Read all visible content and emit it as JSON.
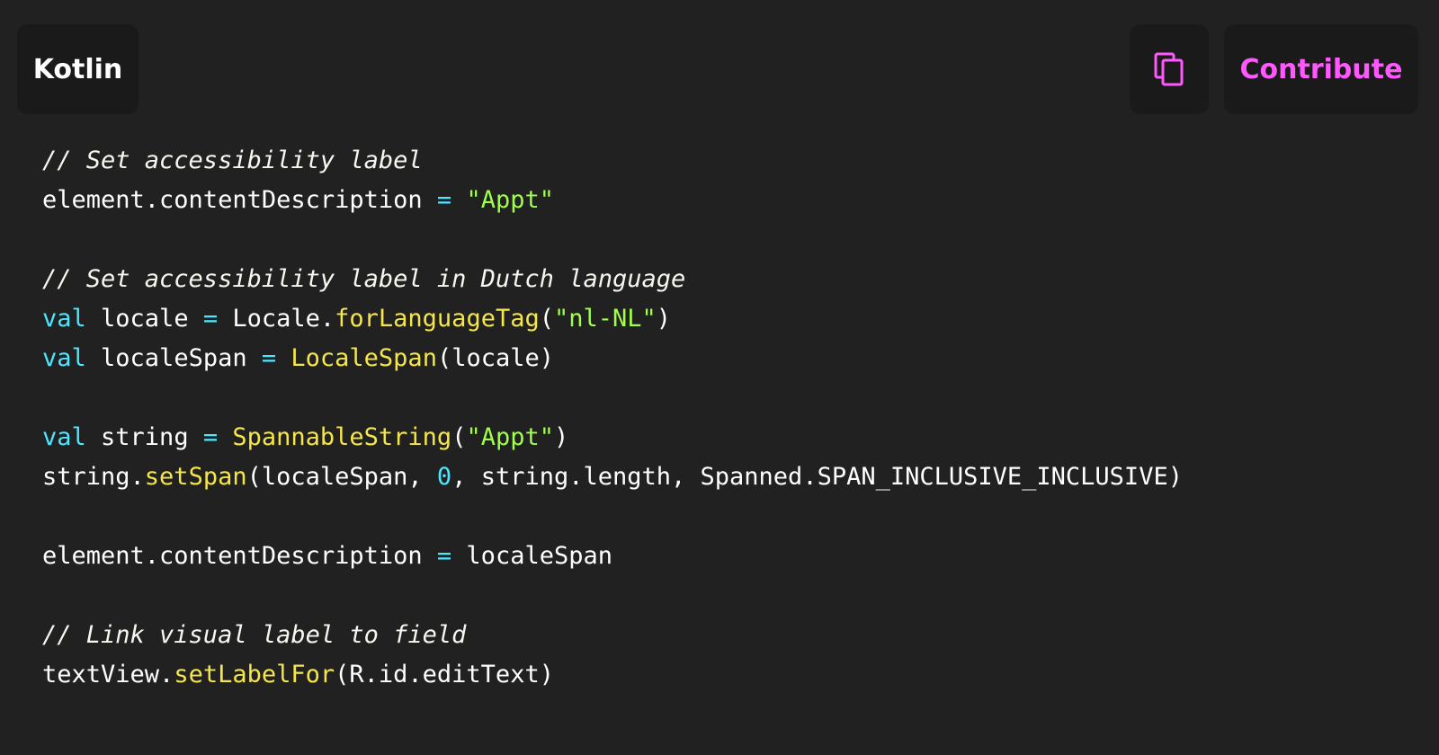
{
  "header": {
    "language_label": "Kotlin",
    "copy_icon": "copy-icon",
    "contribute_label": "Contribute"
  },
  "colors": {
    "background": "#212121",
    "button_background": "#1a1a1a",
    "accent": "#ff58ff",
    "keyword": "#4ee6ff",
    "function": "#f5e64a",
    "string": "#9fff4a"
  },
  "code": {
    "lines": [
      [
        {
          "text": "// Set accessibility label",
          "type": "cmt"
        }
      ],
      [
        {
          "text": "element.contentDescription ",
          "type": "plain"
        },
        {
          "text": "=",
          "type": "op"
        },
        {
          "text": " ",
          "type": "plain"
        },
        {
          "text": "\"Appt\"",
          "type": "str"
        }
      ],
      [],
      [
        {
          "text": "// Set accessibility label in Dutch language",
          "type": "cmt"
        }
      ],
      [
        {
          "text": "val",
          "type": "kw"
        },
        {
          "text": " locale ",
          "type": "plain"
        },
        {
          "text": "=",
          "type": "op"
        },
        {
          "text": " Locale.",
          "type": "plain"
        },
        {
          "text": "forLanguageTag",
          "type": "fn"
        },
        {
          "text": "(",
          "type": "plain"
        },
        {
          "text": "\"nl-NL\"",
          "type": "str"
        },
        {
          "text": ")",
          "type": "plain"
        }
      ],
      [
        {
          "text": "val",
          "type": "kw"
        },
        {
          "text": " localeSpan ",
          "type": "plain"
        },
        {
          "text": "=",
          "type": "op"
        },
        {
          "text": " ",
          "type": "plain"
        },
        {
          "text": "LocaleSpan",
          "type": "fn"
        },
        {
          "text": "(locale)",
          "type": "plain"
        }
      ],
      [],
      [
        {
          "text": "val",
          "type": "kw"
        },
        {
          "text": " string ",
          "type": "plain"
        },
        {
          "text": "=",
          "type": "op"
        },
        {
          "text": " ",
          "type": "plain"
        },
        {
          "text": "SpannableString",
          "type": "fn"
        },
        {
          "text": "(",
          "type": "plain"
        },
        {
          "text": "\"Appt\"",
          "type": "str"
        },
        {
          "text": ")",
          "type": "plain"
        }
      ],
      [
        {
          "text": "string.",
          "type": "plain"
        },
        {
          "text": "setSpan",
          "type": "fn"
        },
        {
          "text": "(localeSpan, ",
          "type": "plain"
        },
        {
          "text": "0",
          "type": "num"
        },
        {
          "text": ", string.length, Spanned.SPAN_INCLUSIVE_INCLUSIVE)",
          "type": "plain"
        }
      ],
      [],
      [
        {
          "text": "element.contentDescription ",
          "type": "plain"
        },
        {
          "text": "=",
          "type": "op"
        },
        {
          "text": " localeSpan",
          "type": "plain"
        }
      ],
      [],
      [
        {
          "text": "// Link visual label to field",
          "type": "cmt"
        }
      ],
      [
        {
          "text": "textView.",
          "type": "plain"
        },
        {
          "text": "setLabelFor",
          "type": "fn"
        },
        {
          "text": "(R.id.editText)",
          "type": "plain"
        }
      ]
    ]
  }
}
